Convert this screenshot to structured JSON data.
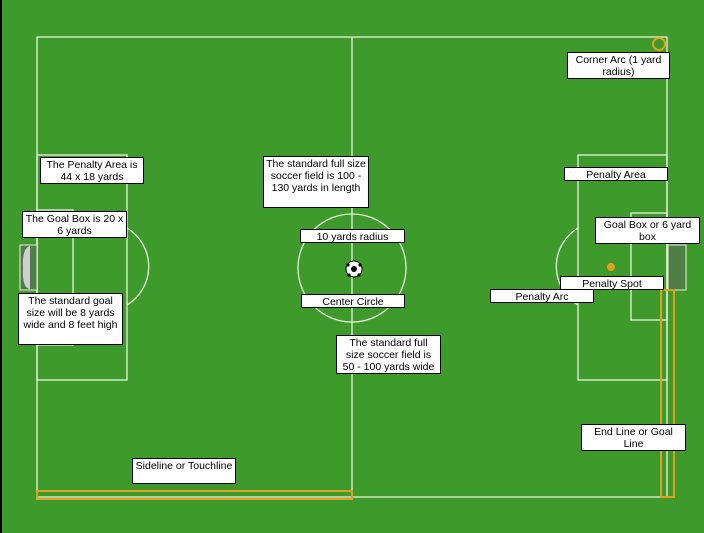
{
  "colors": {
    "grass": "#3e9a2a",
    "lines": "#e8f0e0",
    "highlight": "#e0a020",
    "goal": "#4f7f45"
  },
  "labels": {
    "corner_arc": "Corner Arc (1 yard radius)",
    "penalty_area_size": "The Penalty Area is 44 x 18 yards",
    "field_length": "The standard full size soccer field is 100 - 130 yards in length",
    "penalty_area": "Penalty Area",
    "goal_box_size": "The Goal Box is 20 x 6 yards",
    "ten_yards_radius": "10 yards radius",
    "goal_box": "Goal Box or 6 yard box",
    "penalty_spot": "Penalty Spot",
    "penalty_arc": "Penalty Arc",
    "center_circle": "Center Circle",
    "goal_size": "The standard goal size will be 8 yards wide and 8 feet high",
    "field_width": "The standard full size soccer field is 50 - 100 yards wide",
    "end_line": "End Line or Goal Line",
    "sideline": "Sideline or Touchline"
  },
  "icons": {
    "ball": "soccer-ball-icon"
  }
}
